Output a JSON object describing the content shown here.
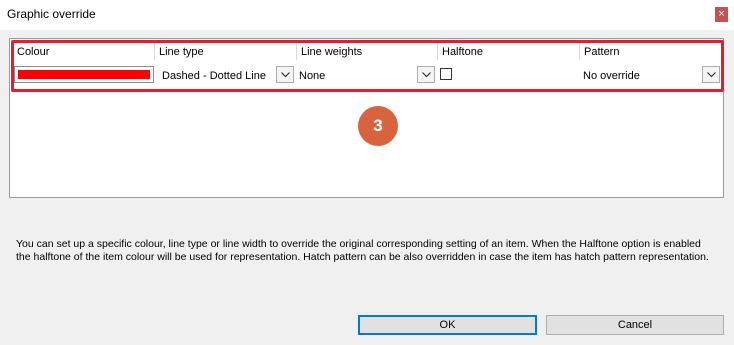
{
  "window": {
    "title": "Graphic override",
    "close_glyph": "×"
  },
  "table": {
    "columns": [
      "Colour",
      "Line type",
      "Line weights",
      "Halftone",
      "Pattern"
    ],
    "row": {
      "colour_value": "#ff0000",
      "line_type": "Dashed - Dotted Line",
      "line_weight": "None",
      "halftone_checked": false,
      "pattern": "No override"
    }
  },
  "annotation": {
    "step_number": "3",
    "highlight_color": "#e81c2e",
    "badge_color": "#d8633f"
  },
  "description": "You can set up a specific colour, line type or line width to override the original corresponding setting of an item. When the Halftone option is enabled the halftone of the item colour will be used for representation. Hatch pattern can be also overridden in case the item has hatch pattern representation.",
  "buttons": {
    "ok": "OK",
    "cancel": "Cancel"
  },
  "icons": {
    "dropdown": "chevron-down-icon",
    "close": "close-icon"
  }
}
